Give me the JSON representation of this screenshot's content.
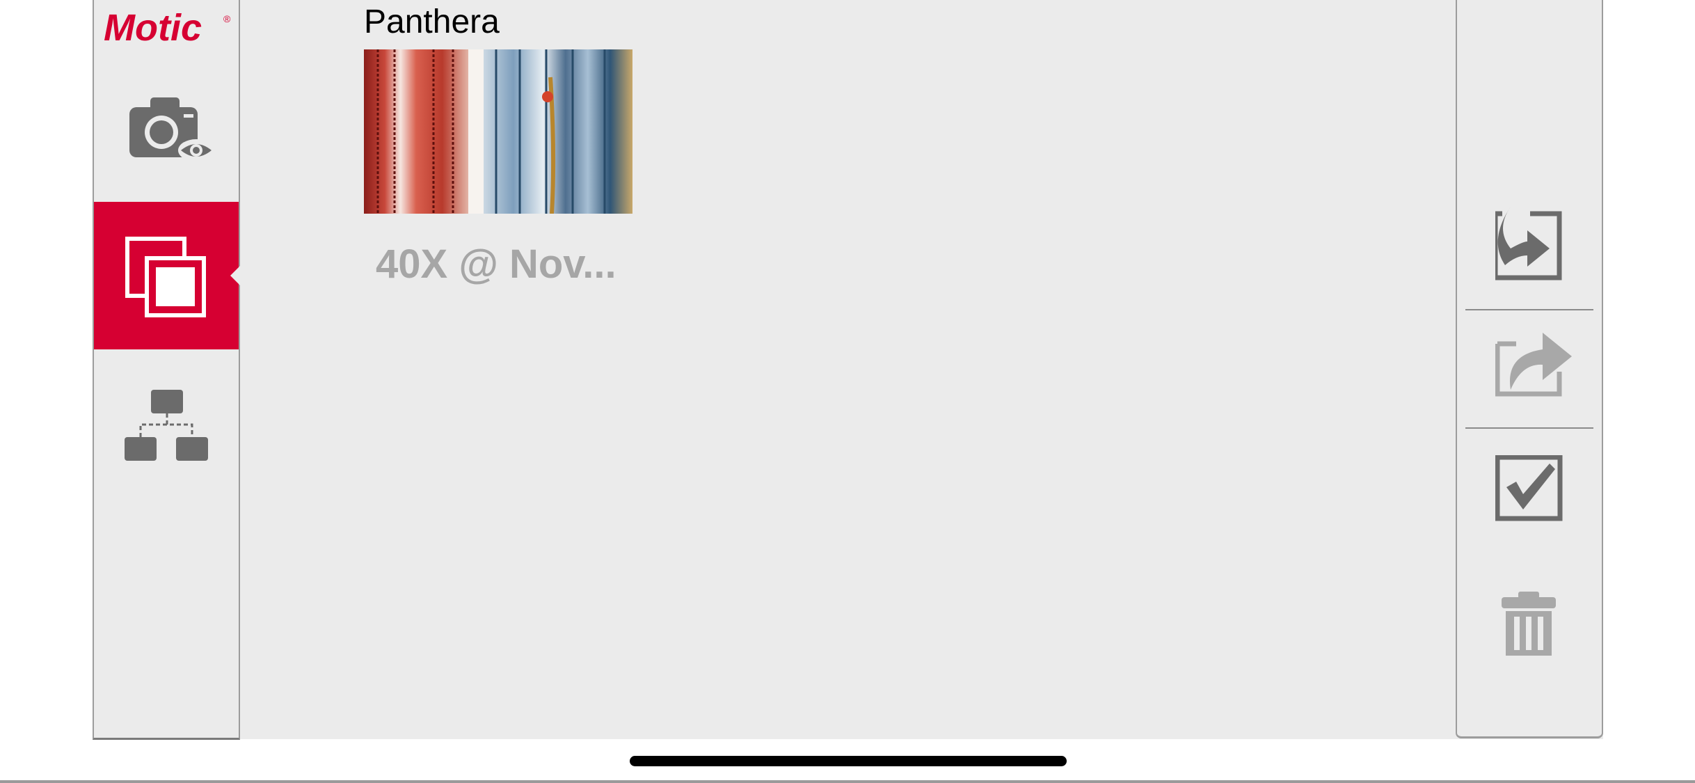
{
  "app": {
    "brand": "Motic",
    "brand_mark": "®"
  },
  "sidebar": {
    "items": [
      {
        "name": "live-view",
        "icon": "camera-eye-icon",
        "active": false
      },
      {
        "name": "gallery",
        "icon": "gallery-stack-icon",
        "active": true
      },
      {
        "name": "network",
        "icon": "network-tree-icon",
        "active": false
      }
    ]
  },
  "album": {
    "title": "Panthera",
    "items": [
      {
        "caption": "40X @ Nov..."
      }
    ]
  },
  "toolbar": {
    "buttons": [
      {
        "name": "import",
        "icon": "import-icon",
        "enabled": true
      },
      {
        "name": "share",
        "icon": "share-icon",
        "enabled": false
      },
      {
        "name": "select",
        "icon": "checkbox-icon",
        "enabled": true
      },
      {
        "name": "delete",
        "icon": "trash-icon",
        "enabled": false
      }
    ]
  },
  "colors": {
    "accent": "#d60032",
    "panel": "#ebebeb",
    "icon": "#6b6b6b",
    "icon_disabled": "#a8a8a8",
    "caption": "#a6a6a6"
  }
}
